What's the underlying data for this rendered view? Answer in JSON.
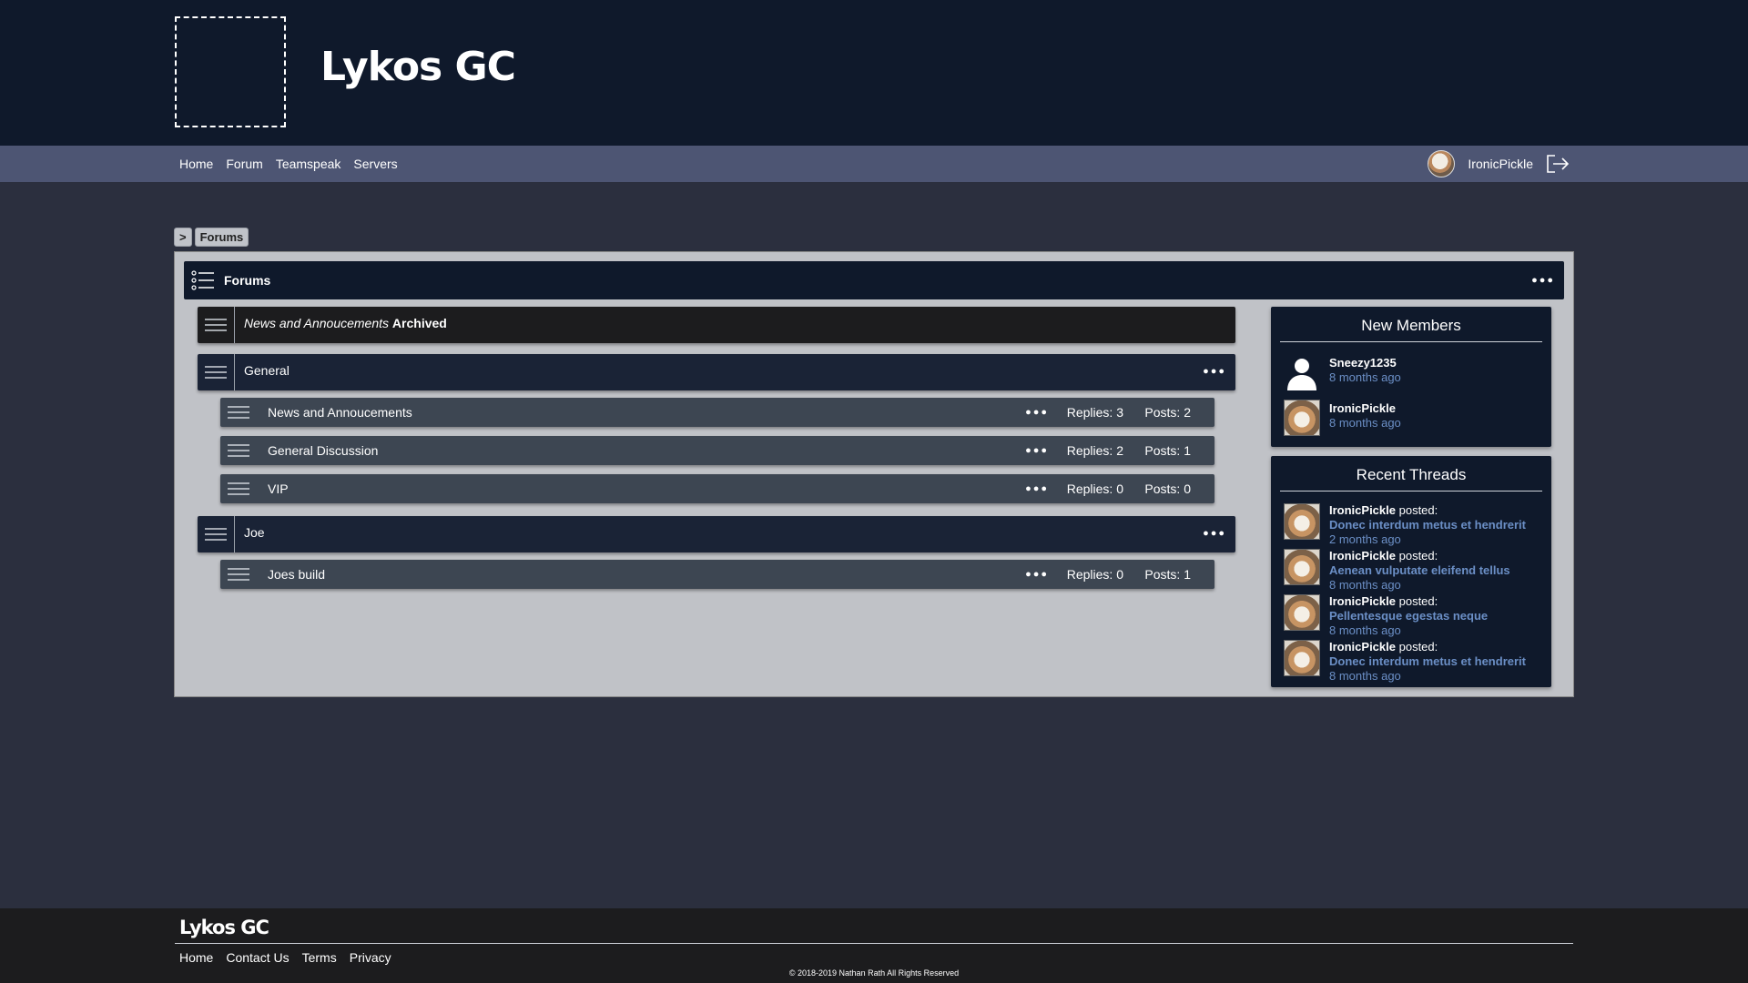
{
  "header": {
    "site_title": "Lykos GC"
  },
  "nav": {
    "links": [
      "Home",
      "Forum",
      "Teamspeak",
      "Servers"
    ],
    "user": {
      "name": "IronicPickle"
    }
  },
  "breadcrumb": {
    "arrow": ">",
    "current": "Forums"
  },
  "forums": {
    "title": "Forums",
    "archived": {
      "label_italic": "News and Annoucements",
      "label_bold": "Archived"
    },
    "categories": [
      {
        "name": "General",
        "subforums": [
          {
            "name": "News and Annoucements",
            "replies": "Replies: 3",
            "posts": "Posts: 2"
          },
          {
            "name": "General Discussion",
            "replies": "Replies: 2",
            "posts": "Posts: 1"
          },
          {
            "name": "VIP",
            "replies": "Replies: 0",
            "posts": "Posts: 0"
          }
        ]
      },
      {
        "name": "Joe",
        "subforums": [
          {
            "name": "Joes build",
            "replies": "Replies: 0",
            "posts": "Posts: 1"
          }
        ]
      }
    ]
  },
  "sidebar": {
    "new_members": {
      "title": "New Members",
      "items": [
        {
          "name": "Sneezy1235",
          "time": "8 months ago"
        },
        {
          "name": "IronicPickle",
          "time": "8 months ago"
        }
      ]
    },
    "recent_threads": {
      "title": "Recent Threads",
      "posted_label": "posted:",
      "items": [
        {
          "user": "IronicPickle",
          "title": "Donec interdum metus et hendrerit",
          "time": "2 months ago"
        },
        {
          "user": "IronicPickle",
          "title": "Aenean vulputate eleifend tellus",
          "time": "8 months ago"
        },
        {
          "user": "IronicPickle",
          "title": "Pellentesque egestas neque",
          "time": "8 months ago"
        },
        {
          "user": "IronicPickle",
          "title": "Donec interdum metus et hendrerit",
          "time": "8 months ago"
        }
      ]
    }
  },
  "footer": {
    "title": "Lykos GC",
    "links": [
      "Home",
      "Contact Us",
      "Terms",
      "Privacy"
    ],
    "copyright": "© 2018-2019 Nathan Rath All Rights Reserved"
  },
  "icons": {
    "menu_dots": "more-options-icon",
    "burger": "drag-handle-icon",
    "list": "list-icon",
    "logout": "logout-icon"
  },
  "colors": {
    "header_bg": "#0f192b",
    "nav_bg": "#4d5573",
    "panel_bg": "#c0c2c7",
    "subforum_bg": "#3d4652",
    "link_accent": "#6b8fc6"
  }
}
